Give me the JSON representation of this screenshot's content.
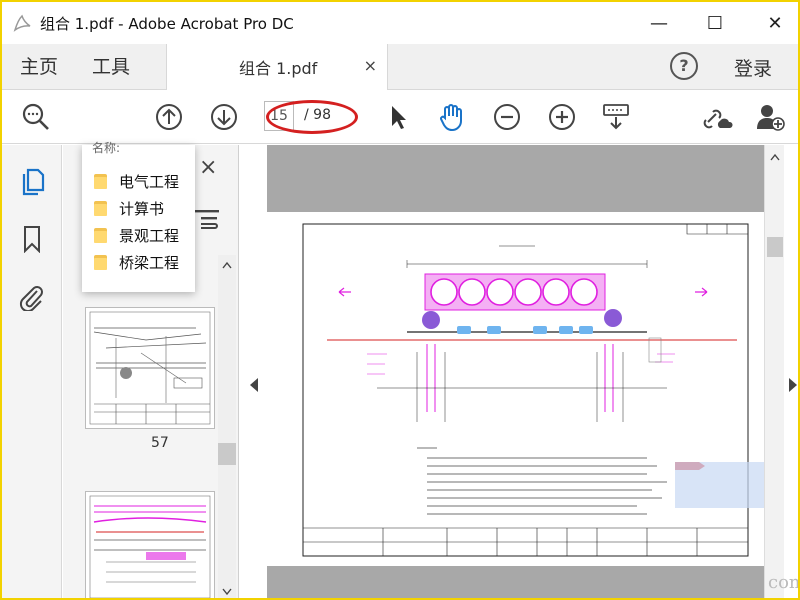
{
  "window": {
    "title": "组合 1.pdf - Adobe Acrobat Pro DC",
    "minimize": "—",
    "maximize": "☐",
    "close": "✕",
    "app_icon": "acrobat-icon"
  },
  "tabbar": {
    "home": "主页",
    "tools": "工具",
    "doc_tab": "组合 1.pdf",
    "doc_tab_close": "×",
    "help": "?",
    "login": "登录"
  },
  "toolbar": {
    "icons": [
      "search-zoom-icon",
      "page-up-icon",
      "page-down-icon",
      "select-arrow-icon",
      "hand-icon",
      "zoom-out-icon",
      "zoom-in-icon",
      "keyboard-scroll-icon",
      "link-cloud-icon",
      "add-user-icon"
    ],
    "current_page": "15",
    "page_total": "/ 98"
  },
  "sidebar": {
    "icons": [
      "pages-icon",
      "bookmark-icon",
      "attachment-icon"
    ],
    "close": "×"
  },
  "bookmark_popup": {
    "header": "名称:",
    "items": [
      {
        "label": "电气工程"
      },
      {
        "label": "计算书"
      },
      {
        "label": "景观工程"
      },
      {
        "label": "桥梁工程"
      }
    ]
  },
  "thumbnails": {
    "page_label": "57"
  },
  "watermark": "com",
  "colors": {
    "border": "#f2d200",
    "accent_blue": "#1a73c8",
    "annotation_red": "#d42020",
    "drawing_magenta": "#e020e0"
  }
}
